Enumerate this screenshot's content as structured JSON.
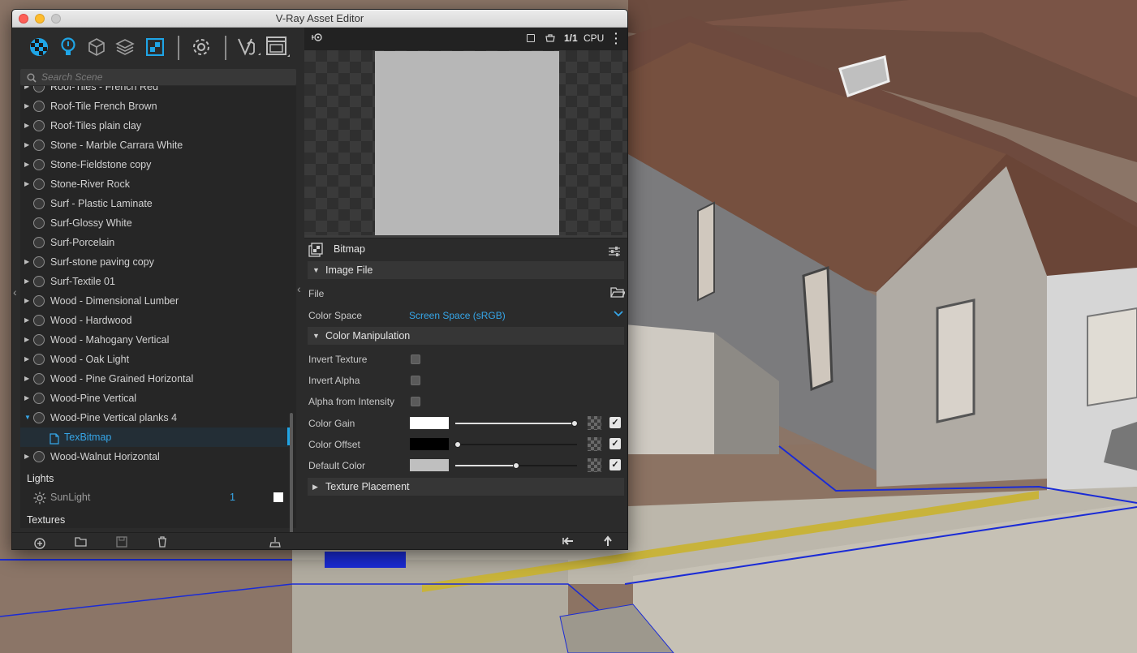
{
  "window": {
    "title": "V-Ray Asset Editor"
  },
  "toolbar": {
    "icons": [
      "materials-icon",
      "lights-icon",
      "geometry-icon",
      "render-elements-icon",
      "textures-icon",
      "settings-icon",
      "interactive-render-icon",
      "frame-buffer-icon"
    ],
    "accent": "#1fa5e6"
  },
  "search": {
    "placeholder": "Search Scene"
  },
  "materials": {
    "items": [
      {
        "label": "Roof-Tiles - French Red",
        "expandable": true
      },
      {
        "label": "Roof-Tile French Brown",
        "expandable": true
      },
      {
        "label": "Roof-Tiles plain clay",
        "expandable": true
      },
      {
        "label": "Stone - Marble Carrara White",
        "expandable": true
      },
      {
        "label": "Stone-Fieldstone copy",
        "expandable": true
      },
      {
        "label": "Stone-River Rock",
        "expandable": true
      },
      {
        "label": "Surf - Plastic Laminate",
        "expandable": false
      },
      {
        "label": "Surf-Glossy White",
        "expandable": false
      },
      {
        "label": "Surf-Porcelain",
        "expandable": false
      },
      {
        "label": "Surf-stone paving copy",
        "expandable": true
      },
      {
        "label": "Surf-Textile 01",
        "expandable": true
      },
      {
        "label": "Wood - Dimensional Lumber",
        "expandable": true
      },
      {
        "label": "Wood - Hardwood",
        "expandable": true
      },
      {
        "label": "Wood - Mahogany Vertical",
        "expandable": true
      },
      {
        "label": "Wood - Oak Light",
        "expandable": true
      },
      {
        "label": "Wood - Pine Grained Horizontal",
        "expandable": true
      },
      {
        "label": "Wood-Pine Vertical",
        "expandable": true
      },
      {
        "label": "Wood-Pine Vertical planks 4",
        "expandable": true,
        "expanded": true
      },
      {
        "label": "TexBitmap",
        "child": true
      },
      {
        "label": "Wood-Walnut Horizontal",
        "expandable": true
      }
    ]
  },
  "lights": {
    "header": "Lights",
    "items": [
      {
        "label": "SunLight",
        "count": "1"
      }
    ]
  },
  "textures": {
    "header": "Textures"
  },
  "preview": {
    "ratio": "1/1",
    "engine": "CPU"
  },
  "props": {
    "type": "Bitmap",
    "sections": {
      "image_file": "Image File",
      "color_manipulation": "Color Manipulation",
      "texture_placement": "Texture Placement"
    },
    "file_label": "File",
    "color_space_label": "Color Space",
    "color_space_value": "Screen Space (sRGB)",
    "invert_texture": "Invert Texture",
    "invert_alpha": "Invert Alpha",
    "alpha_from_intensity": "Alpha from Intensity",
    "color_gain": {
      "label": "Color Gain",
      "color": "#ffffff",
      "level": 1.0
    },
    "color_offset": {
      "label": "Color Offset",
      "color": "#000000",
      "level": 0.0
    },
    "default_color": {
      "label": "Default Color",
      "color": "#bfbfbf",
      "level": 0.5
    }
  }
}
